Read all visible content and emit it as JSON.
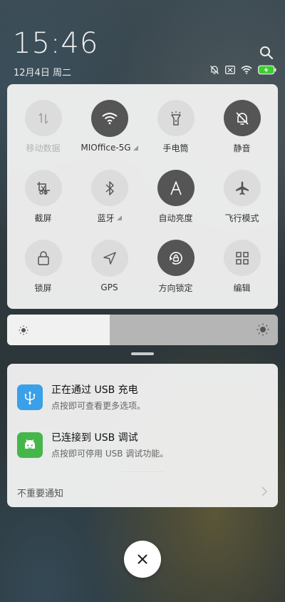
{
  "status": {
    "time": "15:46",
    "date": "12月4日 周二"
  },
  "quick_settings": {
    "tiles": [
      {
        "label": "移动数据",
        "icon": "mobile-data-icon",
        "active": false,
        "disabled": true
      },
      {
        "label": "MIOffice-5G",
        "icon": "wifi-icon",
        "active": true,
        "disabled": false,
        "expandable": true
      },
      {
        "label": "手电筒",
        "icon": "flashlight-icon",
        "active": false,
        "disabled": false
      },
      {
        "label": "静音",
        "icon": "mute-icon",
        "active": true,
        "disabled": false
      },
      {
        "label": "截屏",
        "icon": "screenshot-icon",
        "active": false,
        "disabled": false
      },
      {
        "label": "蓝牙",
        "icon": "bluetooth-icon",
        "active": false,
        "disabled": false,
        "expandable": true
      },
      {
        "label": "自动亮度",
        "icon": "auto-brightness-icon",
        "active": true,
        "disabled": false
      },
      {
        "label": "飞行模式",
        "icon": "airplane-icon",
        "active": false,
        "disabled": false
      },
      {
        "label": "锁屏",
        "icon": "lock-icon",
        "active": false,
        "disabled": false
      },
      {
        "label": "GPS",
        "icon": "gps-icon",
        "active": false,
        "disabled": false
      },
      {
        "label": "方向锁定",
        "icon": "rotation-lock-icon",
        "active": true,
        "disabled": false
      },
      {
        "label": "编辑",
        "icon": "edit-grid-icon",
        "active": false,
        "disabled": false
      }
    ]
  },
  "brightness": {
    "level": 0.379
  },
  "notifications": [
    {
      "title": "正在通过 USB 充电",
      "body": "点按即可查看更多选项。",
      "icon": "usb-icon",
      "color": "#3aa0e8"
    },
    {
      "title": "已连接到 USB 调试",
      "body": "点按即可停用 USB 调试功能。",
      "icon": "android-icon",
      "color": "#45b74a"
    }
  ],
  "unimportant_label": "不重要通知",
  "colors": {
    "tile_active": "#555555",
    "tile_inactive": "#dcdcdc",
    "battery_green": "#3ccf2f"
  }
}
